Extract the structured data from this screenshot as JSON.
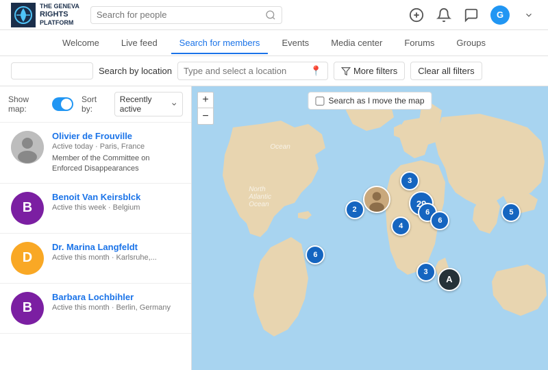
{
  "app": {
    "name": "The Geneva Rights Platform"
  },
  "header": {
    "search_placeholder": "Search for people",
    "avatar_letter": "G"
  },
  "nav": {
    "items": [
      {
        "label": "Welcome",
        "active": false
      },
      {
        "label": "Live feed",
        "active": false
      },
      {
        "label": "Search for members",
        "active": true
      },
      {
        "label": "Events",
        "active": false
      },
      {
        "label": "Media center",
        "active": false
      },
      {
        "label": "Forums",
        "active": false
      },
      {
        "label": "Groups",
        "active": false
      }
    ]
  },
  "filters": {
    "location_label": "Search by location",
    "location_placeholder": "Type and select a location",
    "more_filters_label": "More filters",
    "clear_filters_label": "Clear all filters"
  },
  "controls": {
    "show_map_label": "Show map:",
    "show_map_enabled": true,
    "sort_label": "Sort by:",
    "sort_value": "Recently active"
  },
  "members": [
    {
      "name": "Olivier de Frouville",
      "status": "Active today · Paris, France",
      "description": "Member of the Committee on Enforced Disappearances",
      "avatar_type": "photo",
      "avatar_color": "#9e9e9e",
      "avatar_letter": ""
    },
    {
      "name": "Benoit Van Keirsblck",
      "status": "Active this week · Belgium",
      "description": "",
      "avatar_type": "letter",
      "avatar_color": "#7b1fa2",
      "avatar_letter": "B"
    },
    {
      "name": "Dr. Marina Langfeldt",
      "status": "Active this month · Karlsruhe,...",
      "description": "",
      "avatar_type": "letter",
      "avatar_color": "#f9a825",
      "avatar_letter": "D"
    },
    {
      "name": "Barbara Lochbihler",
      "status": "Active this month · Berlin, Germany",
      "description": "",
      "avatar_type": "letter",
      "avatar_color": "#7b1fa2",
      "avatar_letter": "B"
    }
  ],
  "map": {
    "search_as_move": "Search as I move the map",
    "clusters": [
      {
        "count": "3",
        "size": "sm",
        "top": "32%",
        "left": "72%"
      },
      {
        "count": "29",
        "size": "md",
        "top": "38%",
        "left": "61%"
      },
      {
        "count": "6",
        "size": "sm",
        "top": "41%",
        "left": "66%"
      },
      {
        "count": "6",
        "size": "sm",
        "top": "43%",
        "left": "68%"
      },
      {
        "count": "4",
        "size": "sm",
        "top": "45%",
        "left": "57%"
      },
      {
        "count": "2",
        "size": "sm",
        "top": "41%",
        "left": "48%"
      },
      {
        "count": "6",
        "size": "sm",
        "top": "55%",
        "left": "37%"
      },
      {
        "count": "3",
        "size": "sm",
        "top": "63%",
        "left": "66%"
      },
      {
        "count": "5",
        "size": "sm",
        "top": "43%",
        "left": "87%"
      },
      {
        "count": "A",
        "size": "md dark",
        "top": "66%",
        "left": "72%"
      }
    ]
  }
}
